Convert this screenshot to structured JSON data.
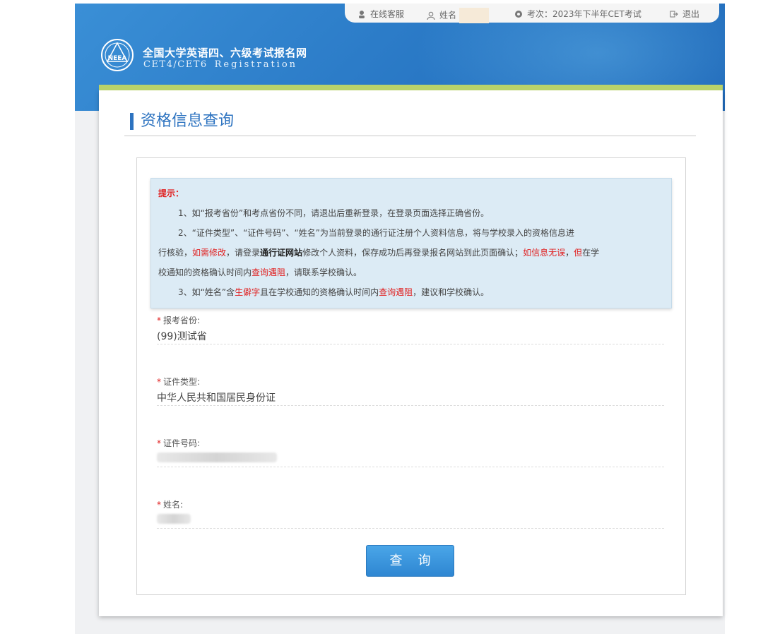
{
  "topbar": {
    "service": "在线客服",
    "name_label": "姓名",
    "exam": "考次：2023年下半年CET考试",
    "logout": "退出"
  },
  "site": {
    "logo_text": "NEEA",
    "title": "全国大学英语四、六级考试报名网",
    "subtitle": "CET4/CET6",
    "subtitle_reg": "Registration"
  },
  "page": {
    "title": "资格信息查询"
  },
  "notice": {
    "header": "提示：",
    "l1": "1、如“报考省份”和考点省份不同，请退出后重新登录，在登录页面选择正确省份。",
    "l2": "2、“证件类型”、“证件号码”、“姓名”为当前登录的通行证注册个人资料信息，将与学校录入的资格信息进",
    "l3a": "行核验，",
    "l3b": "如需修改",
    "l3c": "，请登录",
    "l3d": "通行证网站",
    "l3e": "修改个人资料，保存成功后再登录报名网站到此页面确认；",
    "l3f": "如信息无误",
    "l3g": "，",
    "l3h": "但",
    "l3i": "在学",
    "l4a": "校通知的资格确认时间内",
    "l4b": "查询遇阻",
    "l4c": "，请联系学校确认。",
    "l5a": "3、如“姓名”含",
    "l5b": "生僻字",
    "l5c": "且在学校通知的资格确认时间内",
    "l5d": "查询遇阻",
    "l5e": "，建议和学校确认。"
  },
  "fields": [
    {
      "label": "报考省份:",
      "value": "(99)测试省"
    },
    {
      "label": "证件类型:",
      "value": "中华人民共和国居民身份证"
    },
    {
      "label": "证件号码:",
      "value": ""
    },
    {
      "label": "姓名:",
      "value": ""
    }
  ],
  "button": {
    "query": "查询"
  },
  "colors": {
    "accent": "#2d73c0",
    "warning": "#e02020",
    "green_bar": "#b9d26a"
  }
}
